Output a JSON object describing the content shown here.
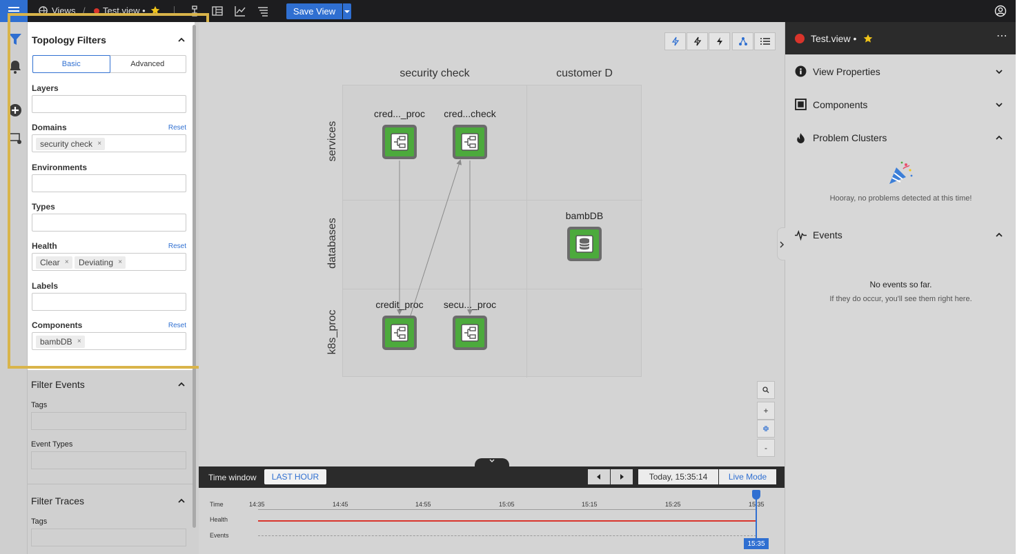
{
  "topbar": {
    "breadcrumb_views": "Views",
    "breadcrumb_sep": "/",
    "breadcrumb_view": "Test.view •",
    "save_label": "Save View"
  },
  "filters": {
    "title": "Topology Filters",
    "mode_basic": "Basic",
    "mode_advanced": "Advanced",
    "layers_label": "Layers",
    "domains_label": "Domains",
    "domains_reset": "Reset",
    "domain_chip": "security check",
    "environments_label": "Environments",
    "types_label": "Types",
    "health_label": "Health",
    "health_reset": "Reset",
    "health_chip_1": "Clear",
    "health_chip_2": "Deviating",
    "labels_label": "Labels",
    "components_label": "Components",
    "components_reset": "Reset",
    "component_chip": "bambDB",
    "events_title": "Filter Events",
    "events_tags": "Tags",
    "events_types": "Event Types",
    "traces_title": "Filter Traces",
    "traces_tags": "Tags"
  },
  "canvas": {
    "columns": [
      "security check",
      "customer D"
    ],
    "rows": [
      "services",
      "databases",
      "k8s_proc"
    ],
    "nodes": {
      "n1": "cred..._proc",
      "n2": "cred...check",
      "n3": "bambDB",
      "n4": "credit_proc",
      "n5": "secu..._proc"
    },
    "zoom": {
      "search": "",
      "plus": "+",
      "minus": "-"
    }
  },
  "timebar": {
    "label": "Time window",
    "range": "LAST HOUR",
    "now": "Today, 15:35:14",
    "live": "Live Mode",
    "ticks": [
      "14:35",
      "14:45",
      "14:55",
      "15:05",
      "15:15",
      "15:25",
      "15:35"
    ],
    "rows": [
      "Time",
      "Health",
      "Events"
    ],
    "cursor": "15:35",
    "health_color": "#d9342b"
  },
  "right": {
    "title": "Test.view •",
    "view_properties": "View Properties",
    "components": "Components",
    "problem_clusters": "Problem Clusters",
    "problems_empty": "Hooray, no problems detected at this time!",
    "events": "Events",
    "events_empty_title": "No events so far.",
    "events_empty_sub": "If they do occur, you'll see them right here."
  },
  "colors": {
    "accent": "#2f6fd1",
    "node_green": "#4caa3c",
    "status_red": "#d9342b",
    "star": "#f0c419"
  }
}
